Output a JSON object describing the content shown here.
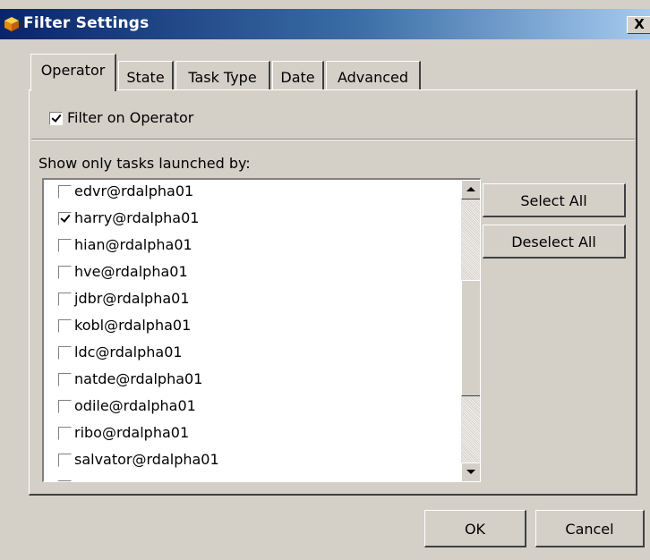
{
  "window": {
    "title": "Filter Settings",
    "close_label": "X"
  },
  "tabs": [
    {
      "label": "Operator",
      "active": true
    },
    {
      "label": "State",
      "active": false
    },
    {
      "label": "Task Type",
      "active": false
    },
    {
      "label": "Date",
      "active": false
    },
    {
      "label": "Advanced",
      "active": false
    }
  ],
  "operator_panel": {
    "filter_checkbox": {
      "label": "Filter on Operator",
      "checked": true
    },
    "list_heading": "Show only tasks launched by:",
    "operators": [
      {
        "name": "edvr@rdalpha01",
        "checked": false
      },
      {
        "name": "harry@rdalpha01",
        "checked": true
      },
      {
        "name": "hian@rdalpha01",
        "checked": false
      },
      {
        "name": "hve@rdalpha01",
        "checked": false
      },
      {
        "name": "jdbr@rdalpha01",
        "checked": false
      },
      {
        "name": "kobl@rdalpha01",
        "checked": false
      },
      {
        "name": "ldc@rdalpha01",
        "checked": false
      },
      {
        "name": "natde@rdalpha01",
        "checked": false
      },
      {
        "name": "odile@rdalpha01",
        "checked": false
      },
      {
        "name": "ribo@rdalpha01",
        "checked": false
      },
      {
        "name": "salvator@rdalpha01",
        "checked": false
      }
    ],
    "select_all_label": "Select All",
    "deselect_all_label": "Deselect All"
  },
  "footer": {
    "ok_label": "OK",
    "cancel_label": "Cancel"
  },
  "colors": {
    "titlebar_start": "#0a246a",
    "titlebar_end": "#a6caf0",
    "dialog_face": "#d4d0c8"
  },
  "icons": {
    "title": "app-cube-icon",
    "scroll_up": "arrow-up-icon",
    "scroll_down": "arrow-down-icon"
  }
}
